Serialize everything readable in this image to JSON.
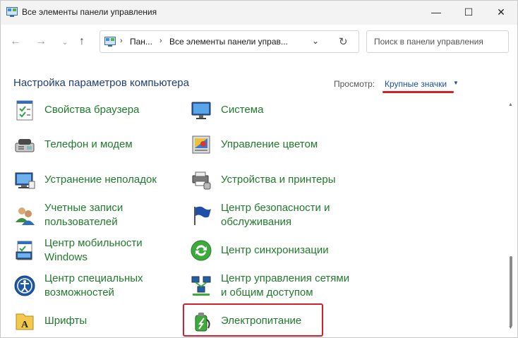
{
  "window": {
    "title": "Все элементы панели управления",
    "minimize_glyph": "—",
    "maximize_glyph": "☐",
    "close_glyph": "✕"
  },
  "nav": {
    "back_glyph": "←",
    "forward_glyph": "→",
    "recent_glyph": "⌄",
    "up_glyph": "↑",
    "breadcrumb": [
      "Пан...",
      "Все элементы панели управ..."
    ],
    "chevron_glyph": "⌄",
    "refresh_glyph": "↻",
    "search_placeholder": "Поиск в панели управления"
  },
  "header": {
    "title": "Настройка параметров компьютера",
    "view_label": "Просмотр:",
    "view_value": "Крупные значки",
    "view_arrow": "▼"
  },
  "items": [
    {
      "label": "Свойства браузера",
      "icon": "internet-options-icon"
    },
    {
      "label": "Система",
      "icon": "system-icon"
    },
    {
      "label": "Телефон и модем",
      "icon": "phone-modem-icon"
    },
    {
      "label": "Управление цветом",
      "icon": "color-management-icon"
    },
    {
      "label": "Устранение неполадок",
      "icon": "troubleshooting-icon"
    },
    {
      "label": "Устройства и принтеры",
      "icon": "devices-printers-icon"
    },
    {
      "label": "Учетные записи\nпользователей",
      "icon": "user-accounts-icon"
    },
    {
      "label": "Центр безопасности и\nобслуживания",
      "icon": "security-maintenance-icon"
    },
    {
      "label": "Центр мобильности\nWindows",
      "icon": "mobility-center-icon"
    },
    {
      "label": "Центр синхронизации",
      "icon": "sync-center-icon"
    },
    {
      "label": "Центр специальных\nвозможностей",
      "icon": "ease-of-access-icon"
    },
    {
      "label": "Центр управления сетями\nи общим доступом",
      "icon": "network-sharing-icon"
    },
    {
      "label": "Шрифты",
      "icon": "fonts-icon"
    },
    {
      "label": "Электропитание",
      "icon": "power-options-icon"
    }
  ],
  "colors": {
    "link_green": "#1f7a2c",
    "title_blue": "#1e3e78",
    "annotation_red": "#d31f2a"
  }
}
